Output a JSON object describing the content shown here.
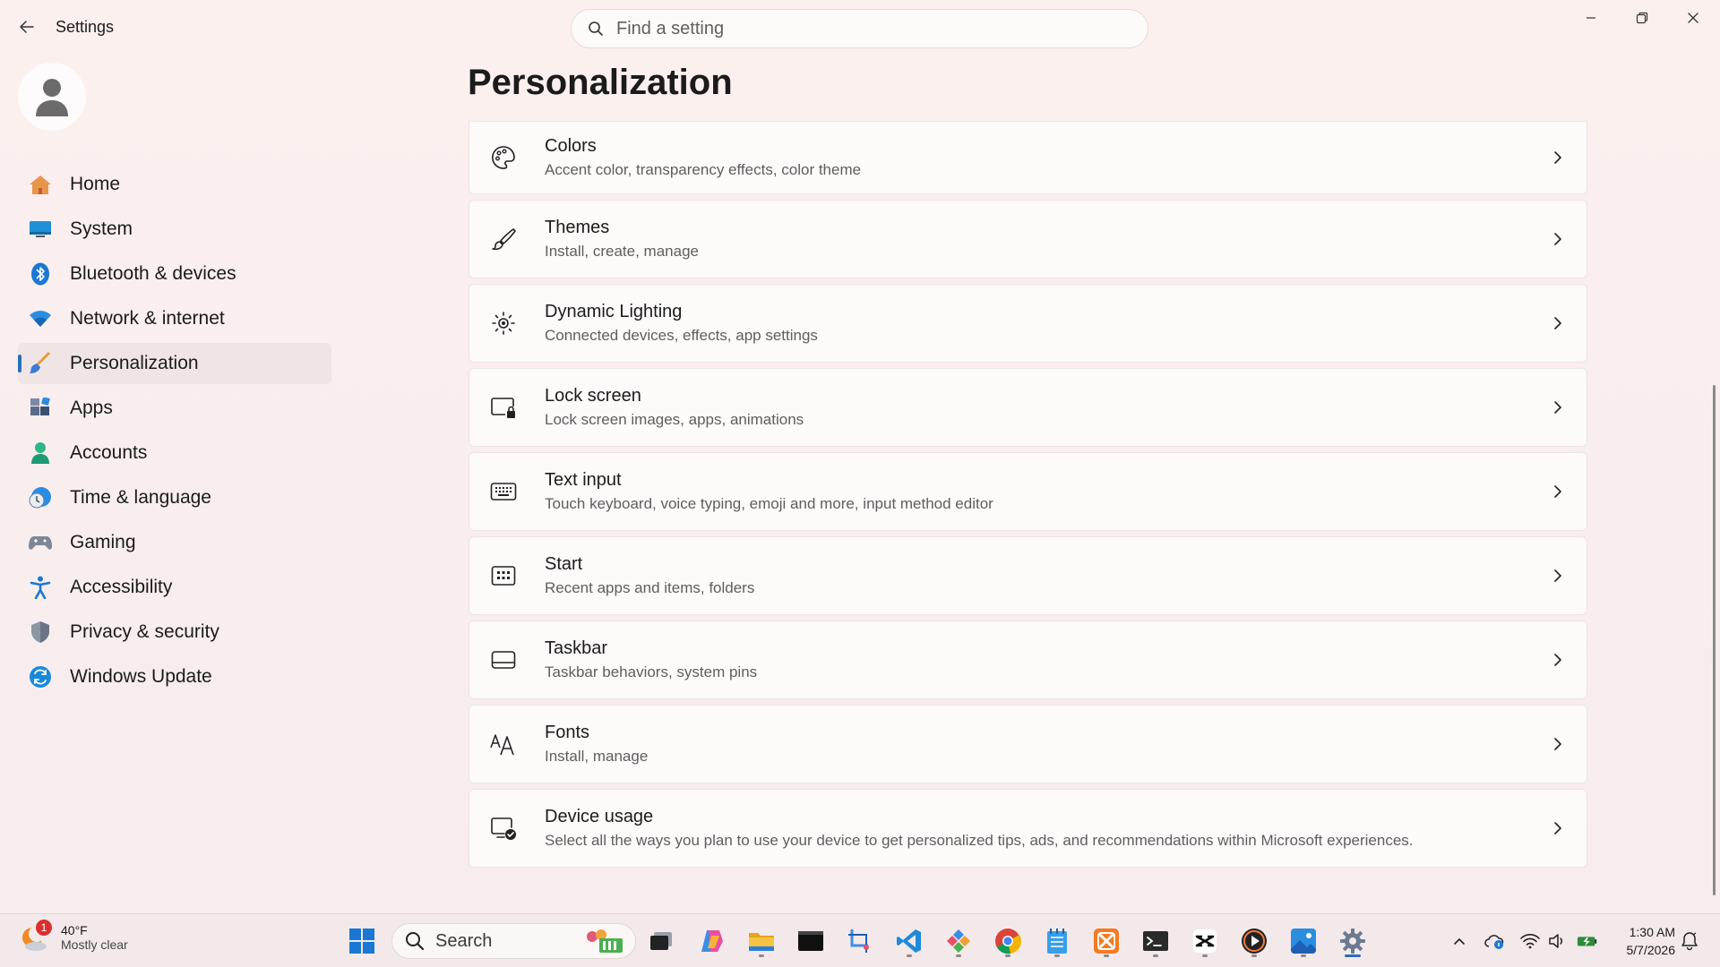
{
  "app": {
    "title": "Settings"
  },
  "search": {
    "placeholder": "Find a setting"
  },
  "nav": {
    "items": [
      {
        "label": "Home",
        "icon": "home-icon"
      },
      {
        "label": "System",
        "icon": "system-icon"
      },
      {
        "label": "Bluetooth & devices",
        "icon": "bluetooth-icon"
      },
      {
        "label": "Network & internet",
        "icon": "wifi-icon"
      },
      {
        "label": "Personalization",
        "icon": "brush-icon",
        "active": true
      },
      {
        "label": "Apps",
        "icon": "apps-icon"
      },
      {
        "label": "Accounts",
        "icon": "accounts-icon"
      },
      {
        "label": "Time & language",
        "icon": "clock-globe-icon"
      },
      {
        "label": "Gaming",
        "icon": "gamepad-icon"
      },
      {
        "label": "Accessibility",
        "icon": "accessibility-icon"
      },
      {
        "label": "Privacy & security",
        "icon": "shield-icon"
      },
      {
        "label": "Windows Update",
        "icon": "update-icon"
      }
    ]
  },
  "main": {
    "title": "Personalization",
    "cards": [
      {
        "title": "Colors",
        "subtitle": "Accent color, transparency effects, color theme",
        "icon": "palette-icon"
      },
      {
        "title": "Themes",
        "subtitle": "Install, create, manage",
        "icon": "brush-icon"
      },
      {
        "title": "Dynamic Lighting",
        "subtitle": "Connected devices, effects, app settings",
        "icon": "lighting-icon"
      },
      {
        "title": "Lock screen",
        "subtitle": "Lock screen images, apps, animations",
        "icon": "lock-screen-icon"
      },
      {
        "title": "Text input",
        "subtitle": "Touch keyboard, voice typing, emoji and more, input method editor",
        "icon": "keyboard-icon"
      },
      {
        "title": "Start",
        "subtitle": "Recent apps and items, folders",
        "icon": "start-icon"
      },
      {
        "title": "Taskbar",
        "subtitle": "Taskbar behaviors, system pins",
        "icon": "taskbar-icon"
      },
      {
        "title": "Fonts",
        "subtitle": "Install, manage",
        "icon": "fonts-icon"
      },
      {
        "title": "Device usage",
        "subtitle": "Select all the ways you plan to use your device to get personalized tips, ads, and recommendations within Microsoft experiences.",
        "icon": "device-usage-icon"
      }
    ]
  },
  "taskbar": {
    "weather": {
      "temp": "40°F",
      "condition": "Mostly clear",
      "badge": "1"
    },
    "search_label": "Search",
    "clock": {
      "time": "1:30 AM",
      "date": "5/7/2026"
    }
  },
  "colors": {
    "accent": "#2a6fb6",
    "background": "#f9eeee",
    "card": "#fdfafa"
  }
}
